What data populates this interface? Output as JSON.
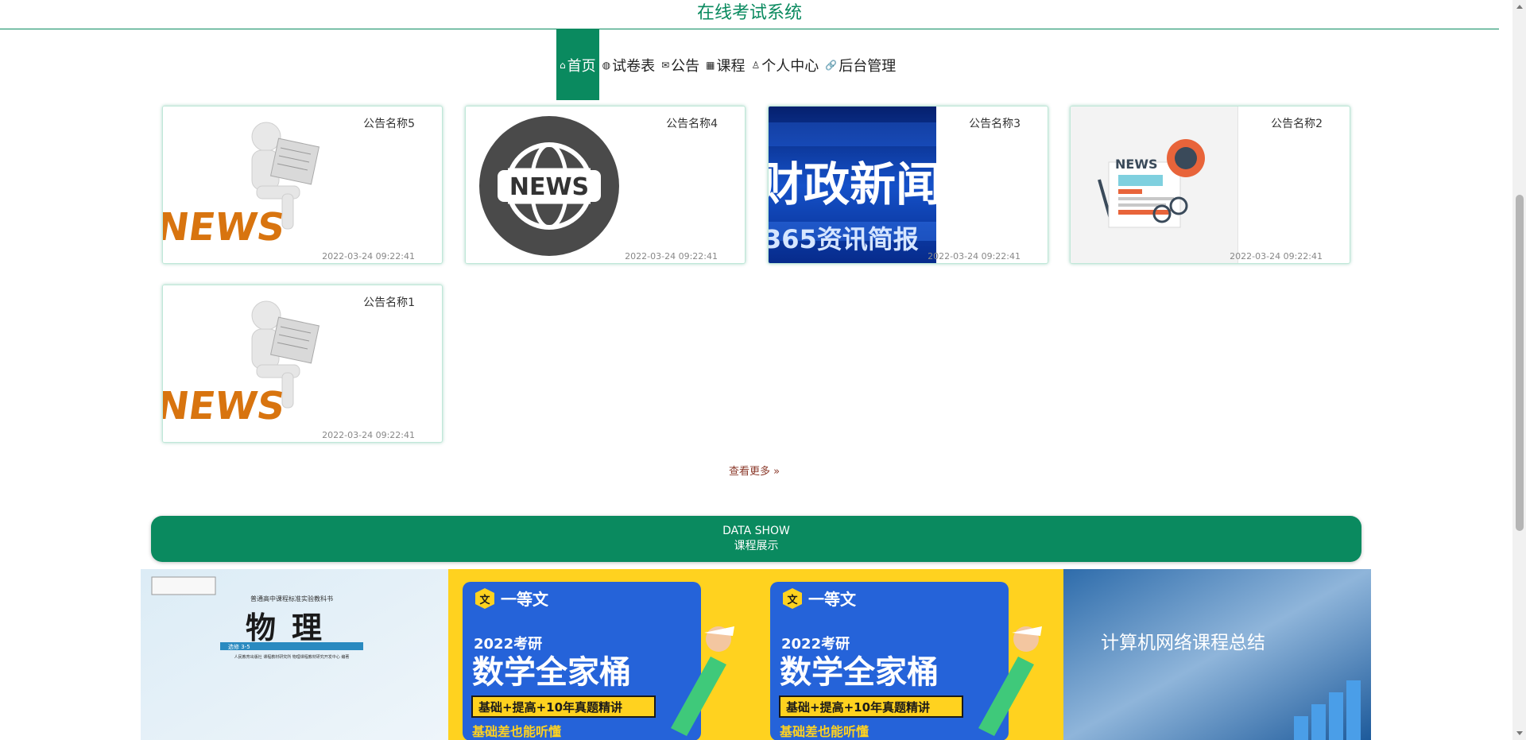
{
  "header": {
    "title": "在线考试系统"
  },
  "nav": [
    {
      "label": "首页",
      "icon": "home-icon",
      "active": true
    },
    {
      "label": "试卷表",
      "icon": "globe-icon"
    },
    {
      "label": "公告",
      "icon": "mail-icon"
    },
    {
      "label": "课程",
      "icon": "grid-icon"
    },
    {
      "label": "个人中心",
      "icon": "user-icon"
    },
    {
      "label": "后台管理",
      "icon": "link-icon"
    }
  ],
  "news": [
    {
      "name": "公告名称5",
      "time": "2022-03-24 09:22:41",
      "image": "news-3d-figure",
      "image_text": "NEWS"
    },
    {
      "name": "公告名称4",
      "time": "2022-03-24 09:22:41",
      "image": "news-globe-circle",
      "image_text": "NEWS"
    },
    {
      "name": "公告名称3",
      "time": "2022-03-24 09:22:41",
      "image": "finance-news-banner",
      "image_text": "财政新闻",
      "image_subtext": "365资讯简报"
    },
    {
      "name": "公告名称2",
      "time": "2022-03-24 09:22:41",
      "image": "newspaper-coffee-illustration",
      "image_text": "NEWS"
    },
    {
      "name": "公告名称1",
      "time": "2022-03-24 09:22:41",
      "image": "news-3d-figure",
      "image_text": "NEWS"
    }
  ],
  "more_link": "查看更多 »",
  "data_show": {
    "title_en": "DATA SHOW",
    "title_cn": "课程展示"
  },
  "courses": [
    {
      "image": "physics-textbook-cover",
      "title": "物理",
      "top_line": "普通高中课程标准实验教科书",
      "sub": "选修 3-5",
      "publisher": "人民教育出版社 课程教材研究所 物理课程教材研究开发中心 编著"
    },
    {
      "image": "math-exam-poster",
      "brand": "一等文",
      "year_line": "2022考研",
      "main": "数学全家桶",
      "tag": "基础+提高+10年真题精讲",
      "bottom": "基础差也能听懂"
    },
    {
      "image": "math-exam-poster",
      "brand": "一等文",
      "year_line": "2022考研",
      "main": "数学全家桶",
      "tag": "基础+提高+10年真题精讲",
      "bottom": "基础差也能听懂"
    },
    {
      "image": "network-course-banner",
      "title": "计算机网络课程总结"
    }
  ],
  "colors": {
    "brand": "#0a8a5f",
    "more_link": "#8b3a2b",
    "poster_yellow": "#ffd21f",
    "poster_blue": "#2563d9"
  }
}
